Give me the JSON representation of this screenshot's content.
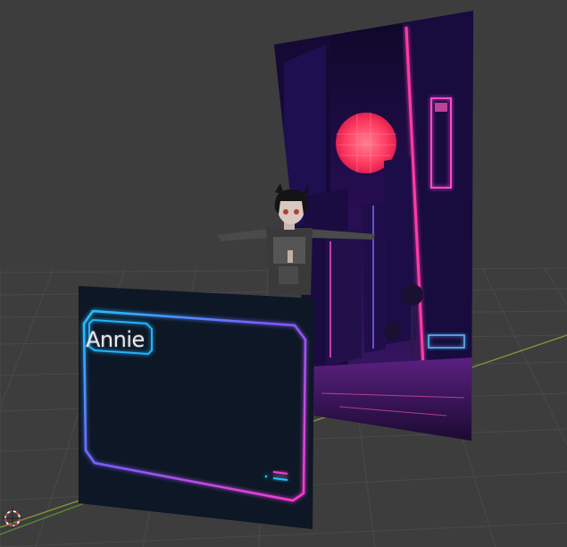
{
  "viewport": {
    "background": "#3d3d3d",
    "grid_color": "#4a4a4a",
    "x_axis_color": "#8a9a3a",
    "y_axis_color": "#5a8a3a"
  },
  "cyberpunk_plane": {
    "description_icon": "neon-city-icon",
    "sun_color": "#ff4a6a",
    "neon_pink": "#ff3aa8",
    "neon_blue": "#3a6aff",
    "sky_color": "#1a0a3a"
  },
  "character": {
    "icon": "anime-character-icon"
  },
  "dialog_card": {
    "name_text": "Annie",
    "border_cyan": "#22c4ff",
    "border_magenta": "#ff3ad0",
    "panel_color": "#0a1220"
  },
  "origin": {
    "icon": "3d-cursor-icon"
  }
}
